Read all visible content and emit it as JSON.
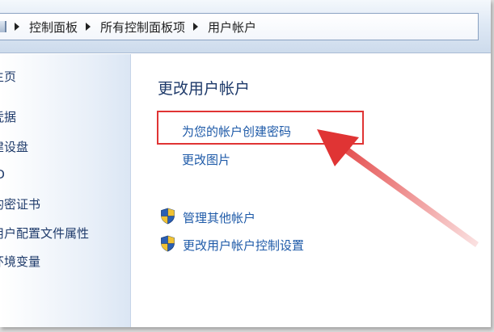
{
  "breadcrumb": {
    "items": [
      {
        "label": "控制面板"
      },
      {
        "label": "所有控制面板项"
      },
      {
        "label": "用户帐户"
      }
    ]
  },
  "left_pane": {
    "items": [
      {
        "label": "主页"
      },
      {
        "label": "凭据"
      },
      {
        "label": "建设盘"
      },
      {
        "label": "ID"
      },
      {
        "label": "的密证书"
      },
      {
        "label": "用户配置文件属性"
      },
      {
        "label": "环境变量"
      }
    ]
  },
  "main": {
    "title": "更改用户帐户",
    "links": {
      "create_password": "为您的帐户创建密码",
      "change_picture": "更改图片",
      "manage_accounts": "管理其他帐户",
      "uac_settings": "更改用户帐户控制设置"
    }
  },
  "colors": {
    "link": "#1e5aa8",
    "heading": "#1e3a6a",
    "annotation": "#e03434"
  },
  "icons": {
    "shield": "uac-shield-icon"
  }
}
